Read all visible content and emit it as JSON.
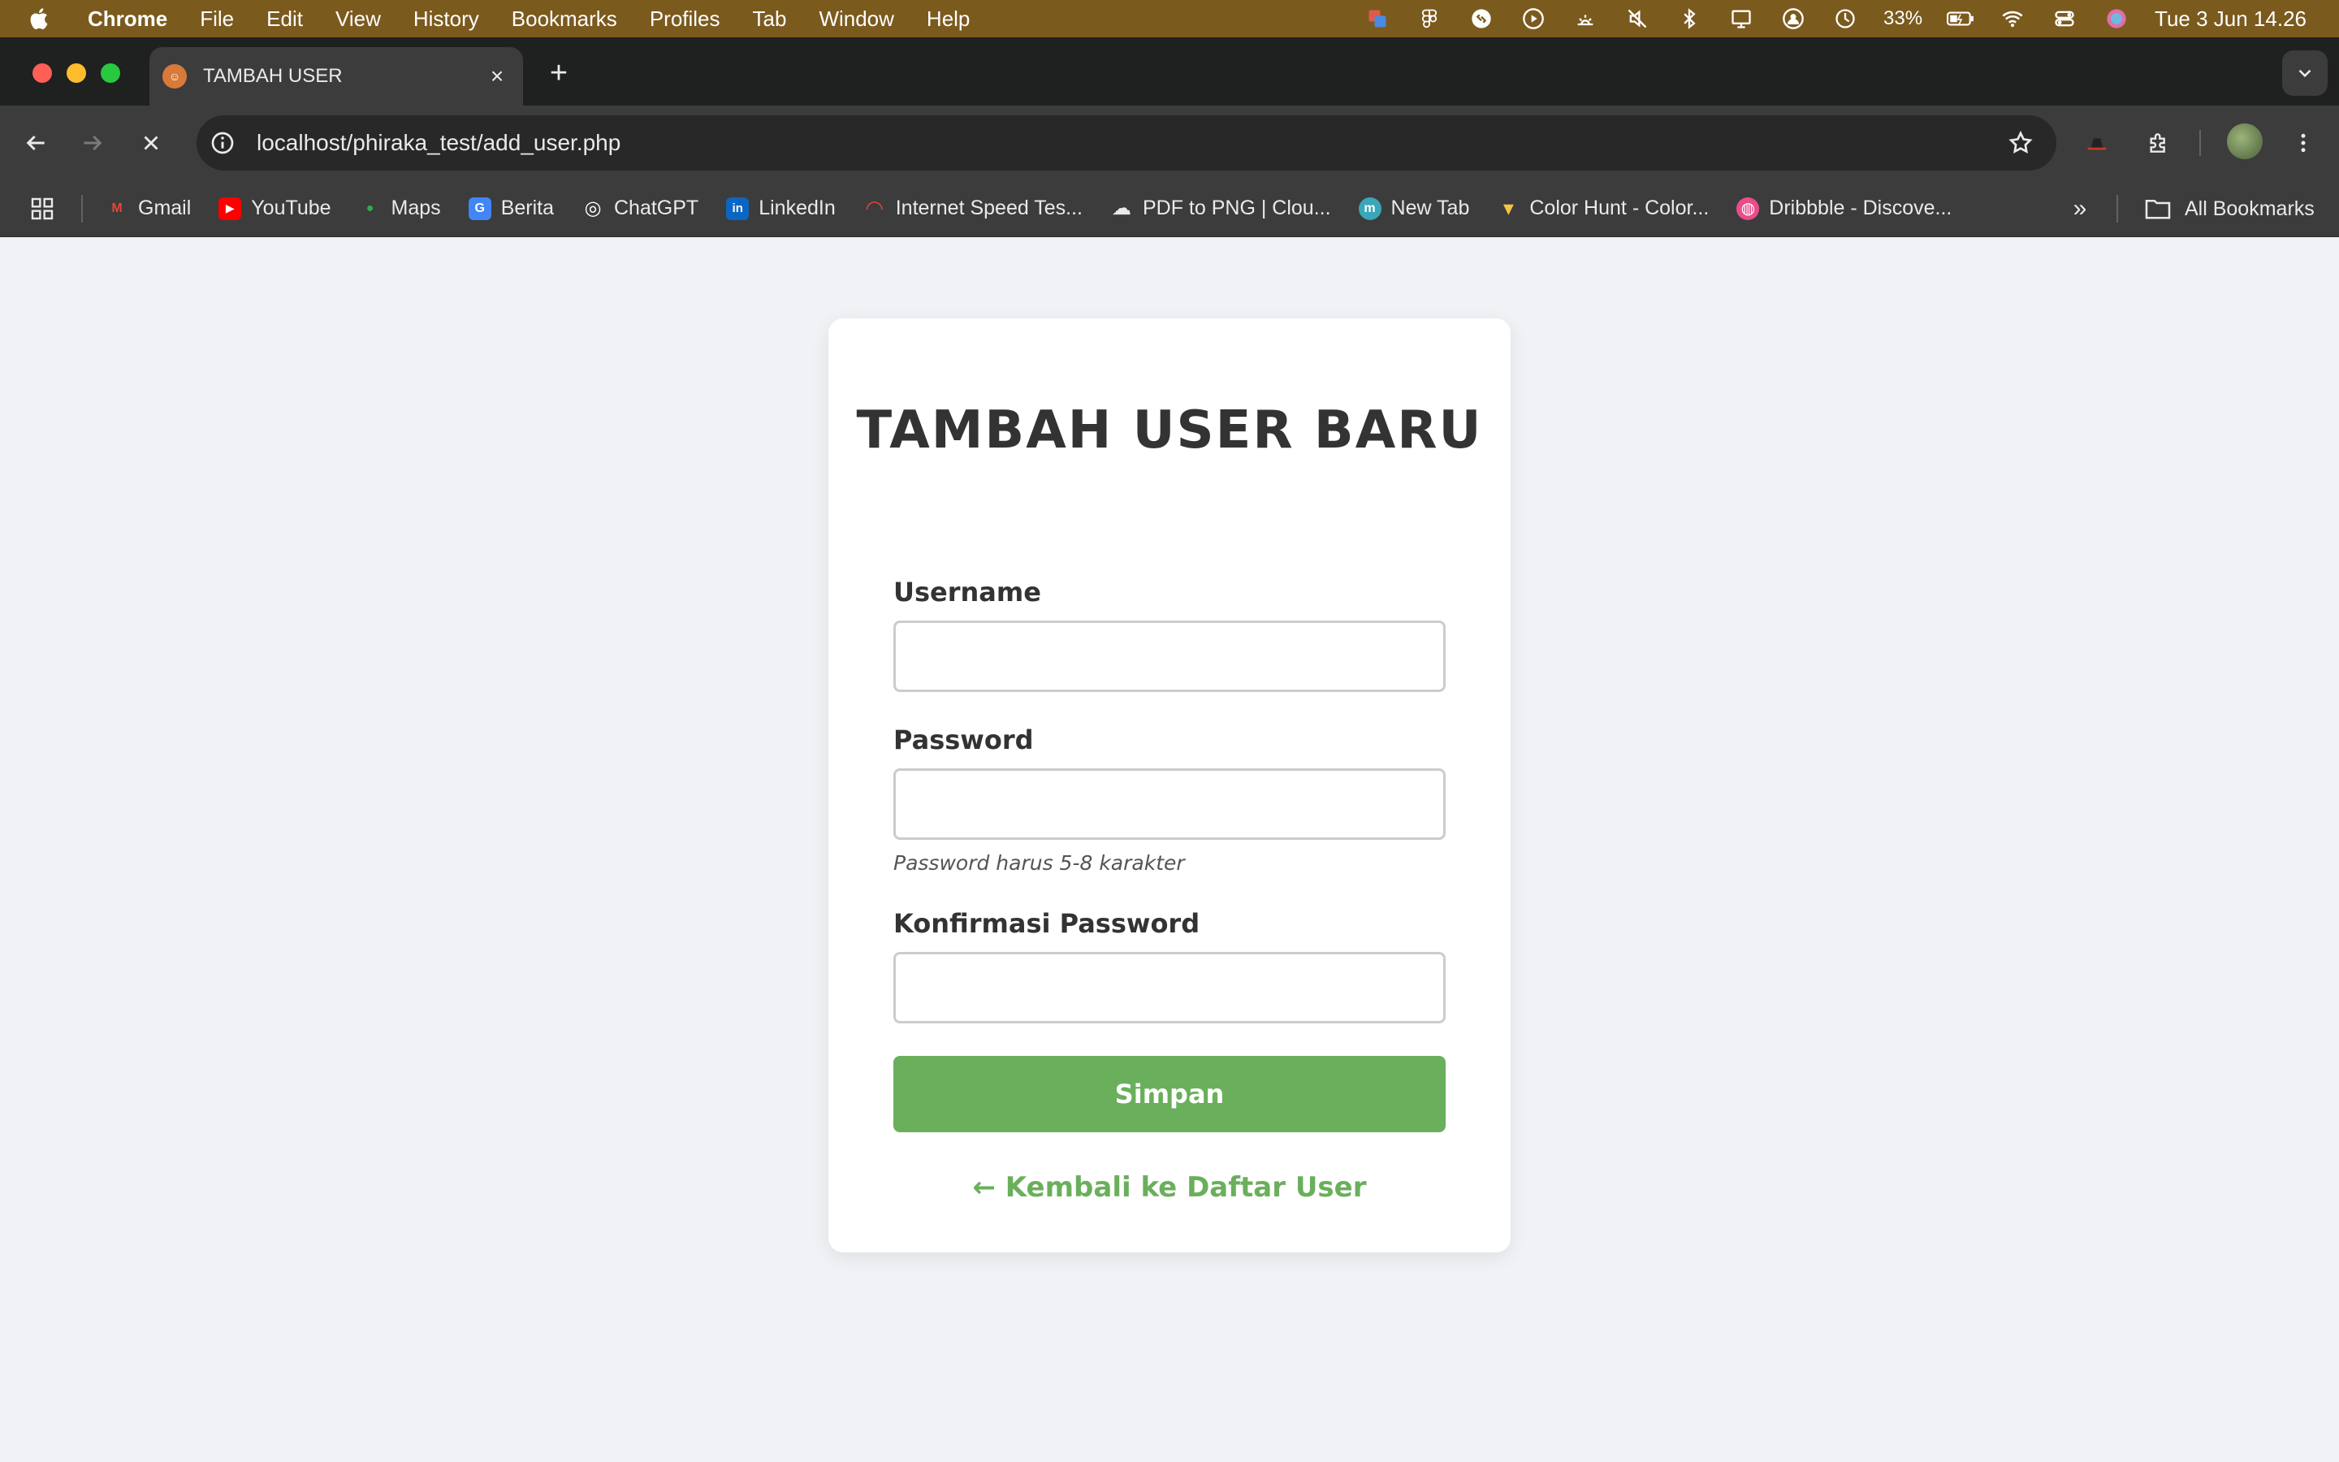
{
  "menubar": {
    "app_name": "Chrome",
    "items": [
      "File",
      "Edit",
      "View",
      "History",
      "Bookmarks",
      "Profiles",
      "Tab",
      "Window",
      "Help"
    ],
    "battery": "33%",
    "clock": "Tue 3 Jun  14.26"
  },
  "browser": {
    "tab_title": "TAMBAH USER",
    "favicon_text": "☺",
    "url": "localhost/phiraka_test/add_user.php"
  },
  "bookmarks": {
    "items": [
      {
        "label": "Gmail",
        "icon_text": "M",
        "color": "#ea4335"
      },
      {
        "label": "YouTube",
        "icon_text": "▶",
        "color": "#ff0000"
      },
      {
        "label": "Maps",
        "icon_text": "●",
        "color": "#34a853"
      },
      {
        "label": "Berita",
        "icon_text": "G",
        "color": "#4285f4"
      },
      {
        "label": "ChatGPT",
        "icon_text": "◎",
        "color": "#3c3c3c"
      },
      {
        "label": "LinkedIn",
        "icon_text": "in",
        "color": "#0a66c2"
      },
      {
        "label": "Internet Speed Tes...",
        "icon_text": "◠",
        "color": "#3c3c3c"
      },
      {
        "label": "PDF to PNG | Clou...",
        "icon_text": "☁",
        "color": "#3c3c3c"
      },
      {
        "label": "New Tab",
        "icon_text": "m",
        "color": "#3aa6b9"
      },
      {
        "label": "Color Hunt - Color...",
        "icon_text": "▾",
        "color": "#3c3c3c"
      },
      {
        "label": "Dribbble - Discove...",
        "icon_text": "◍",
        "color": "#ea4c89"
      }
    ],
    "all_label": "All Bookmarks"
  },
  "form": {
    "title": "TAMBAH USER BARU",
    "username_label": "Username",
    "username_value": "",
    "password_label": "Password",
    "password_value": "",
    "password_hint": "Password harus 5-8 karakter",
    "confirm_label": "Konfirmasi Password",
    "confirm_value": "",
    "submit_label": "Simpan",
    "back_link": "← Kembali ke Daftar User"
  },
  "colors": {
    "accent_green": "#6aaf5c",
    "page_bg": "#f0f2f5",
    "menubar_bg": "#7b5a1e"
  }
}
